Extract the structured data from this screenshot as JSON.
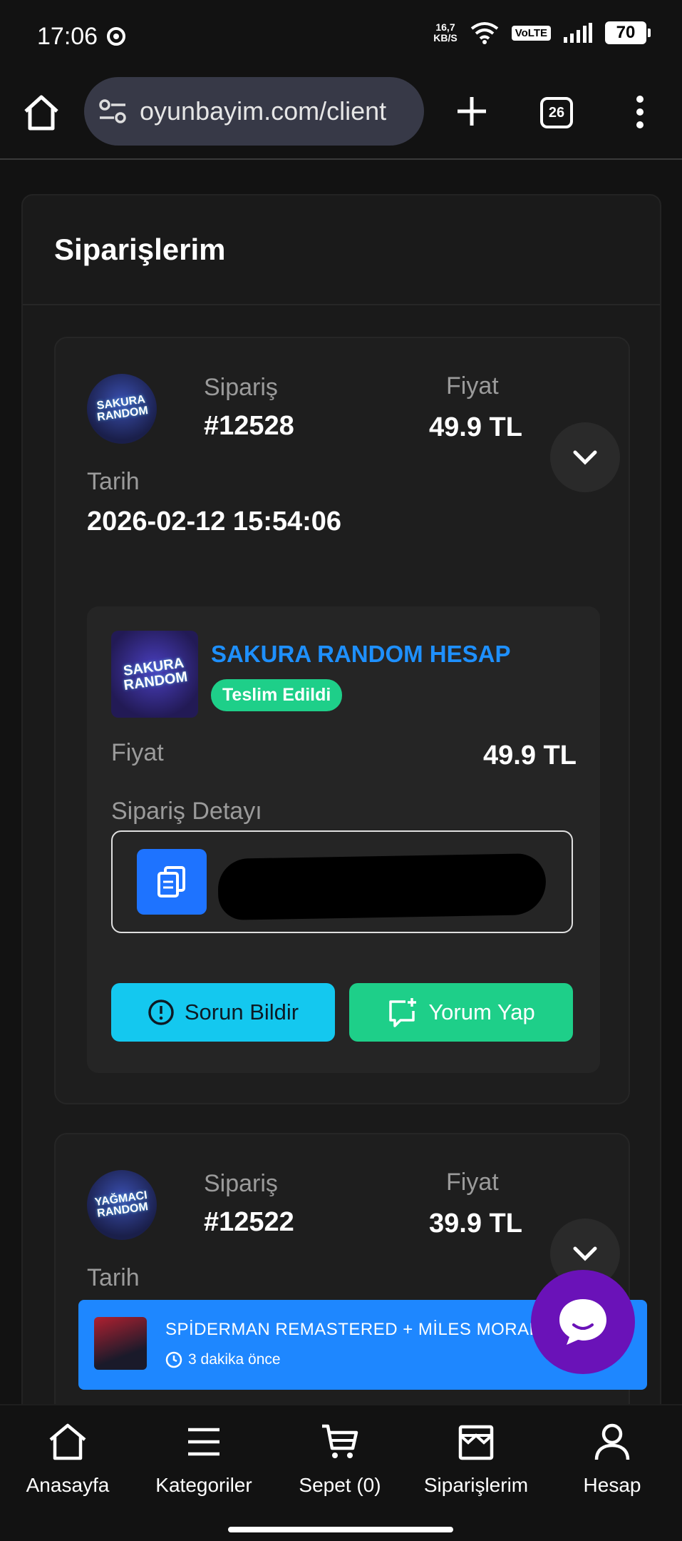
{
  "status_bar": {
    "time": "17:06",
    "net_speed_value": "16,7",
    "net_speed_unit": "KB/S",
    "volte": "VoLTE",
    "battery": "70"
  },
  "browser": {
    "url": "oyunbayim.com/client",
    "tab_count": "26"
  },
  "page": {
    "title": "Siparişlerim"
  },
  "orders": [
    {
      "avatar_text": "SAKURA RANDOM",
      "order_label": "Sipariş",
      "order_number": "#12528",
      "price_label": "Fiyat",
      "price": "49.9 TL",
      "date_label": "Tarih",
      "date": "2026-02-12 15:54:06",
      "product": {
        "image_text": "SAKURA RANDOM",
        "name": "SAKURA RANDOM HESAP",
        "status": "Teslim Edildi",
        "price_label": "Fiyat",
        "price": "49.9 TL",
        "detail_label": "Sipariş Detayı"
      },
      "buttons": {
        "issue": "Sorun Bildir",
        "review": "Yorum Yap"
      }
    },
    {
      "avatar_text": "YAĞMACI RANDOM",
      "order_label": "Sipariş",
      "order_number": "#12522",
      "price_label": "Fiyat",
      "price": "39.9 TL",
      "date_label": "Tarih"
    }
  ],
  "toast": {
    "title": "SPİDERMAN REMASTERED + MİLES MORALES",
    "time": "3 dakika önce"
  },
  "bottom_nav": [
    {
      "label": "Anasayfa",
      "icon": "home-icon"
    },
    {
      "label": "Kategoriler",
      "icon": "menu-icon"
    },
    {
      "label": "Sepet (0)",
      "icon": "cart-icon"
    },
    {
      "label": "Siparişlerim",
      "icon": "store-icon"
    },
    {
      "label": "Hesap",
      "icon": "user-icon"
    }
  ],
  "colors": {
    "accent_blue": "#1e87ff",
    "success_green": "#1ecf89",
    "issue_cyan": "#14c8ef",
    "chat_purple": "#6a12b8"
  }
}
